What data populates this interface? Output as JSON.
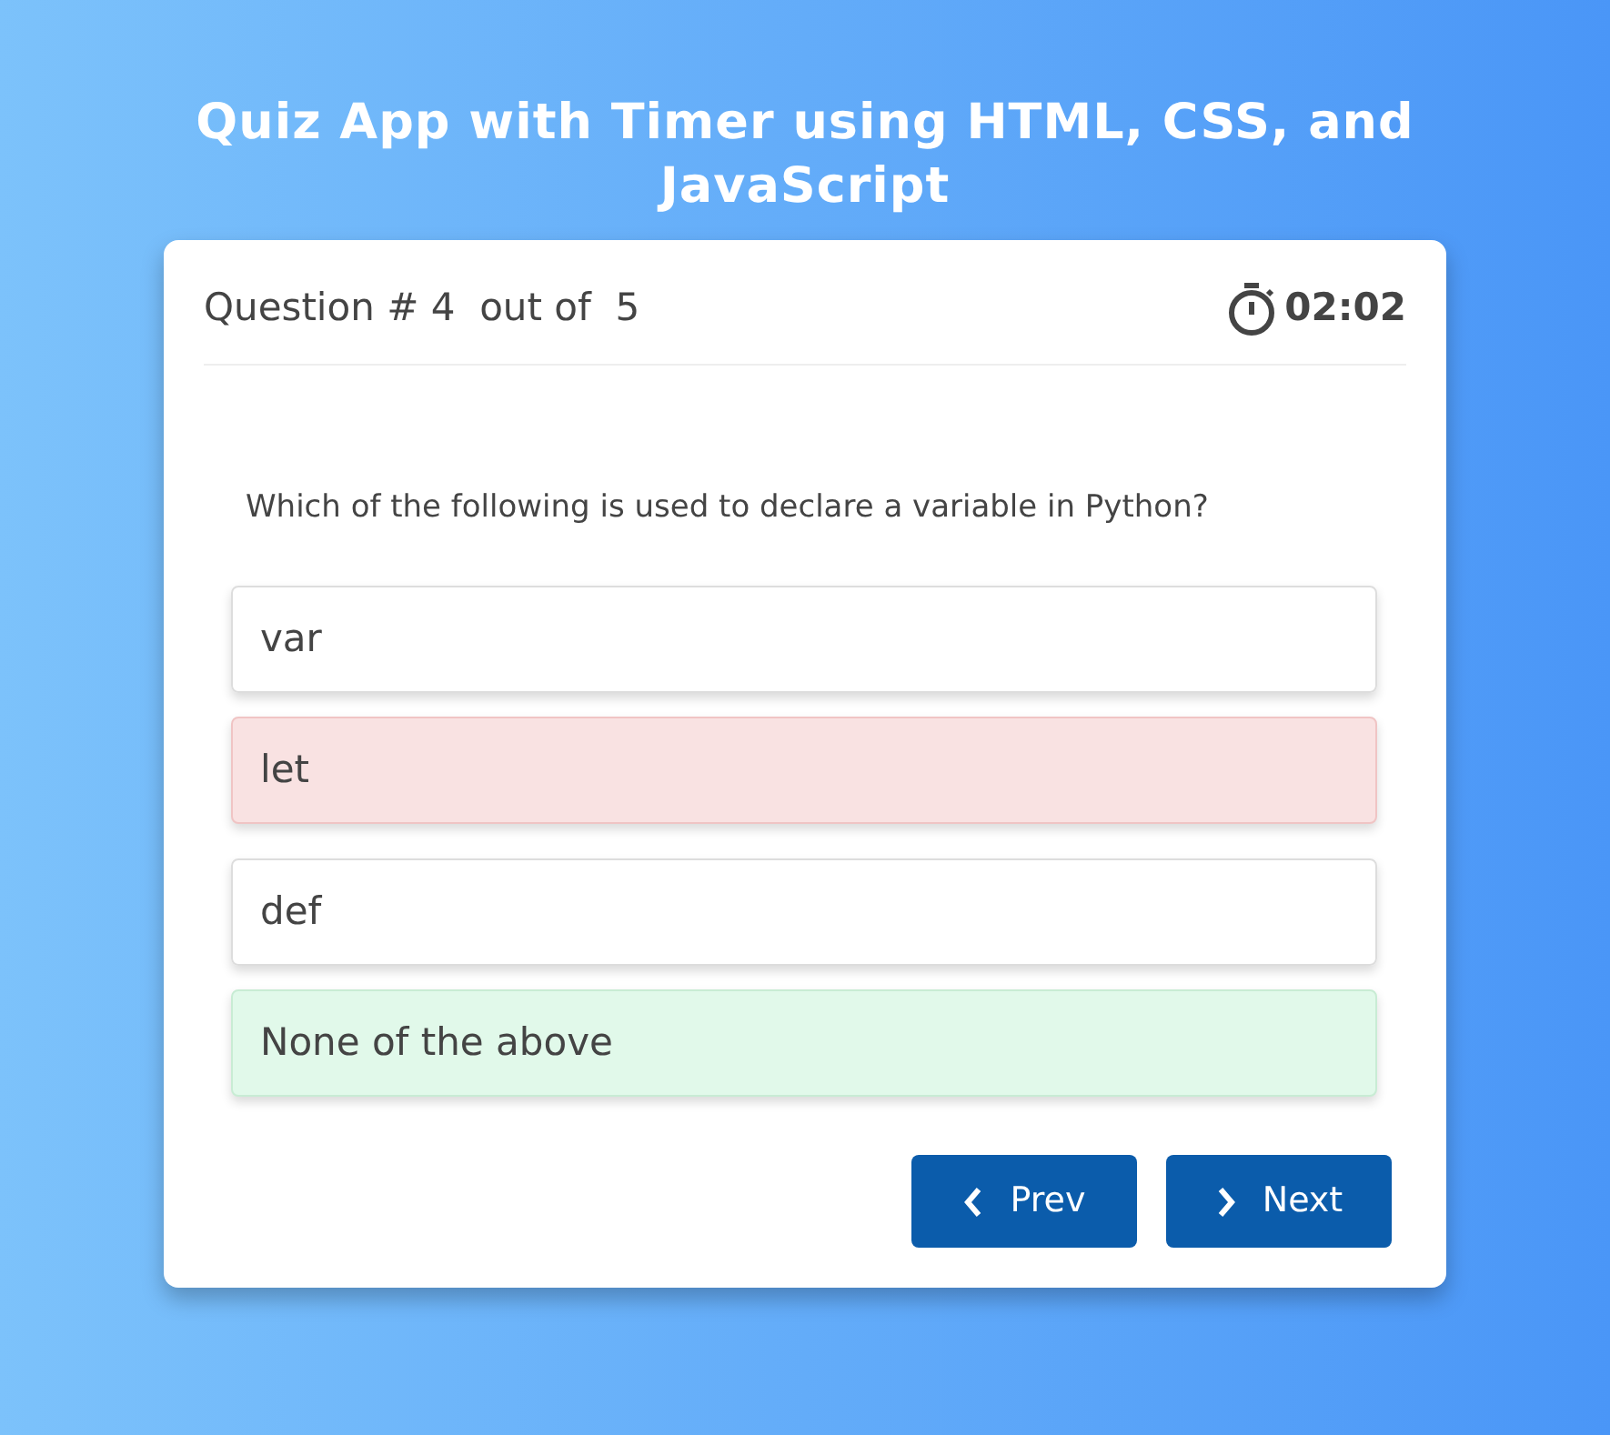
{
  "title": "Quiz App with Timer using HTML, CSS, and JavaScript",
  "quiz": {
    "progress": "Question # 4  out of  5",
    "timer": "02:02",
    "question": "Which of the following is used to declare a variable in Python?",
    "options": [
      {
        "text": "var",
        "kind": "plain"
      },
      {
        "text": "let",
        "kind": "wrong"
      },
      {
        "text": "def",
        "kind": "plain"
      },
      {
        "text": "None of the above",
        "kind": "correct"
      }
    ],
    "buttons": [
      {
        "label": "Prev",
        "kind": "prev"
      },
      {
        "label": "Next",
        "kind": "next"
      }
    ]
  }
}
